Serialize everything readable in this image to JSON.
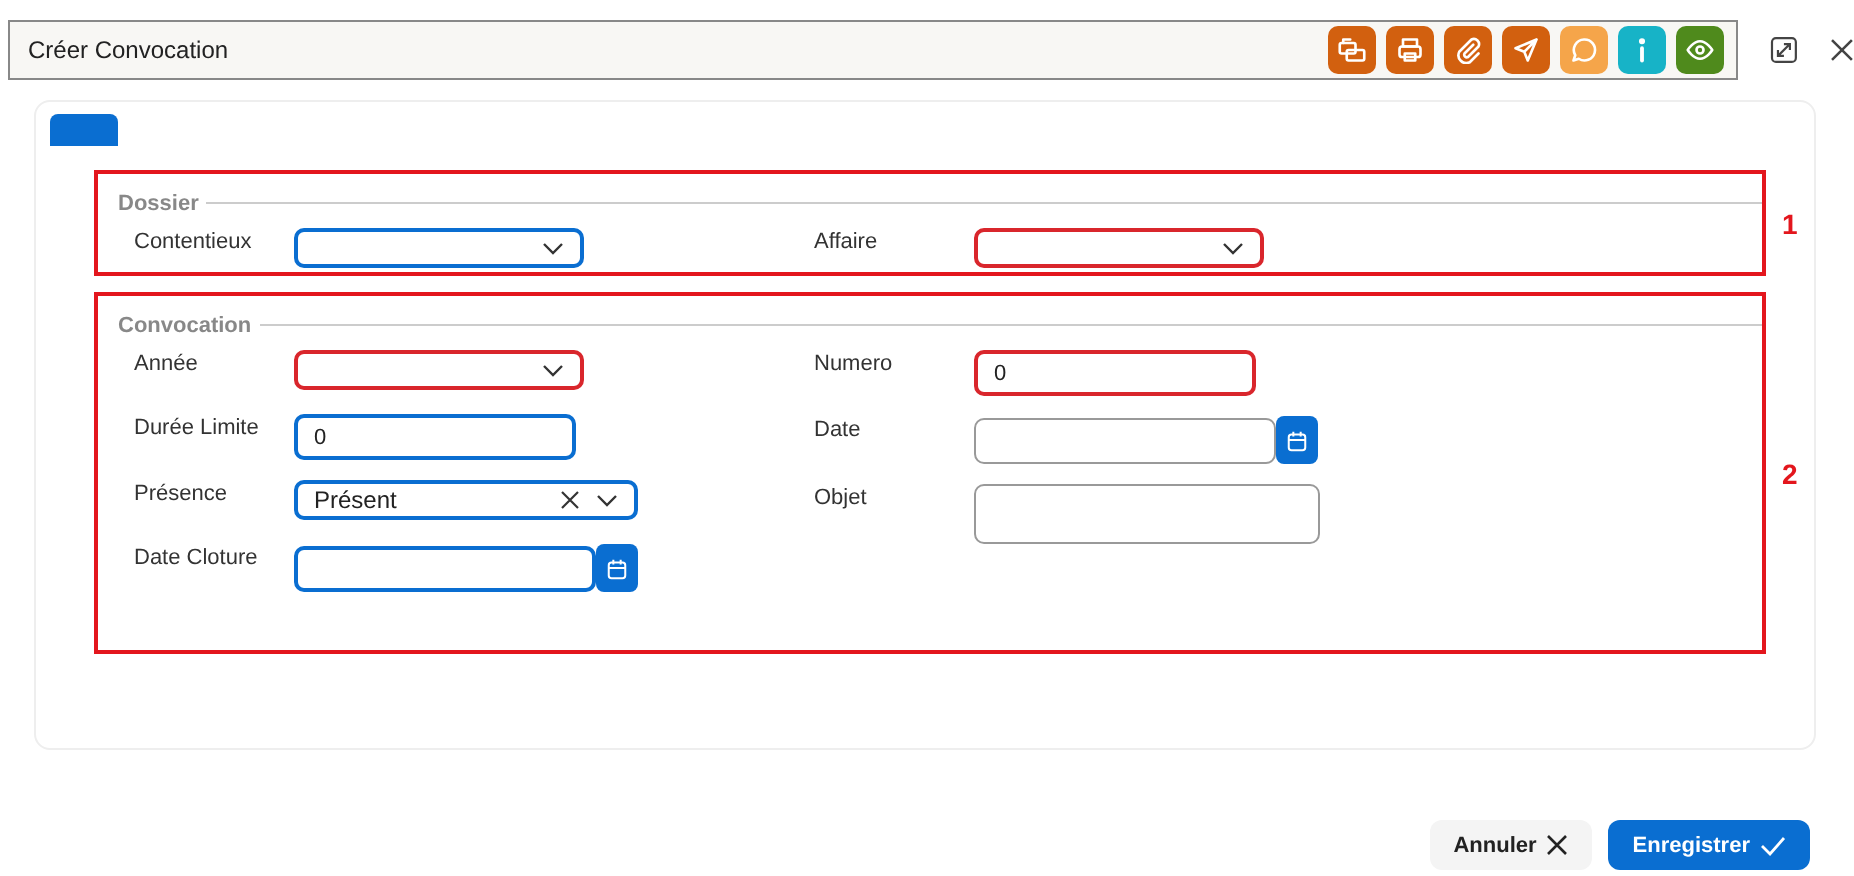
{
  "window": {
    "title": "Créer Convocation"
  },
  "toolbar": [
    {
      "kind": "folders",
      "color": "#d2600f"
    },
    {
      "kind": "print",
      "color": "#d2600f"
    },
    {
      "kind": "clip",
      "color": "#d2600f"
    },
    {
      "kind": "send",
      "color": "#d2600f"
    },
    {
      "kind": "chat",
      "color": "#f5a54a"
    },
    {
      "kind": "info",
      "color": "#17b3c7"
    },
    {
      "kind": "eye",
      "color": "#4f8a1c"
    }
  ],
  "tab": {
    "selected": true
  },
  "sections": [
    {
      "title": "Dossier",
      "annotation": "1",
      "columns": [
        [
          {
            "label": "Contentieux",
            "kind": "select",
            "error": false,
            "focused": true
          }
        ],
        [
          {
            "label": "Affaire",
            "kind": "select",
            "error": true
          }
        ]
      ]
    },
    {
      "title": "Convocation",
      "annotation": "2",
      "columns": [
        [
          {
            "label": "Année",
            "kind": "select",
            "error": true
          },
          {
            "label": "Durée Limite",
            "kind": "text",
            "error": false,
            "focused": true,
            "value": "0"
          },
          {
            "label": "Présence",
            "kind": "select",
            "error": false,
            "focused": true,
            "value": "Présent",
            "clearable": true
          },
          {
            "label": "Date Cloture",
            "kind": "date",
            "error": false,
            "focused": true
          }
        ],
        [
          {
            "label": "Numero",
            "kind": "text",
            "error": true,
            "value": "0"
          },
          {
            "label": "Date",
            "kind": "date",
            "error": false,
            "focused": false
          },
          {
            "label": "Objet",
            "kind": "textarea",
            "error": false,
            "focused": false
          }
        ]
      ]
    }
  ],
  "buttons": [
    {
      "label": "Annuler",
      "kind": "cancel"
    },
    {
      "label": "Enregistrer",
      "kind": "save"
    }
  ]
}
